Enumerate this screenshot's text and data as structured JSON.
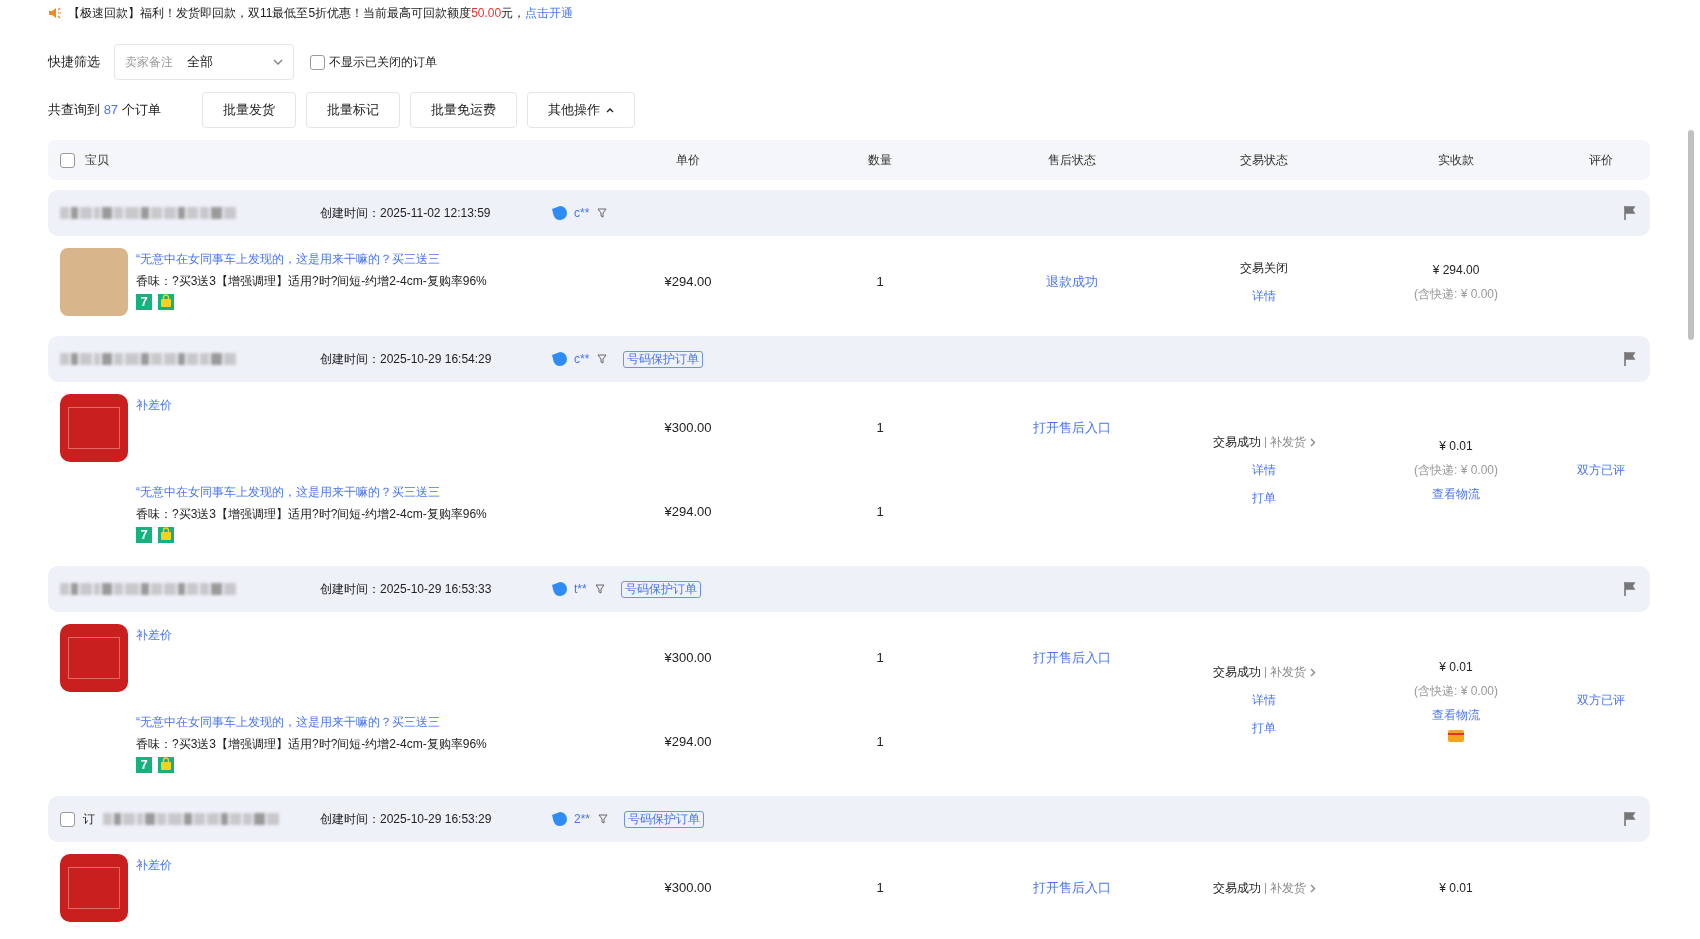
{
  "notice": {
    "text": "【极速回款】福利！发货即回款，双11最低至5折优惠！当前最高可回款额度",
    "amount": "50.00",
    "suffix": "元，",
    "link": "点击开通"
  },
  "filter": {
    "label": "快捷筛选",
    "select_label": "卖家备注",
    "select_value": "全部",
    "hide_closed": {
      "label": "不显示已关闭的订单",
      "checked": false
    }
  },
  "summary": {
    "prefix": "共查询到",
    "count": "87",
    "suffix": "个订单"
  },
  "actions": [
    {
      "label": "批量发货",
      "kind": "plain"
    },
    {
      "label": "批量标记",
      "kind": "plain"
    },
    {
      "label": "批量免运费",
      "kind": "plain"
    },
    {
      "label": "其他操作",
      "kind": "menu",
      "expanded": true
    }
  ],
  "table": {
    "select_all": {
      "checked": false
    },
    "columns": [
      "宝贝",
      "单价",
      "数量",
      "售后状态",
      "交易状态",
      "实收款",
      "评价"
    ]
  },
  "orders": [
    {
      "created": "创建时间：2025-11-02 12:13:59",
      "buyer": "c**",
      "items": [
        {
          "kind": "photo",
          "title": "“无意中在女同事车上发现的，这是用来干嘛的？买三送三",
          "spec": "香味：?买3送3【增强调理】适用?时?间短-约增2-4cm-复购率96%",
          "tags": [
            {
              "kind": "seven",
              "text": "7"
            },
            {
              "kind": "bag"
            }
          ],
          "price": "¥294.00",
          "qty": "1",
          "after_sale": "退款成功"
        }
      ],
      "trade": {
        "status": "交易关闭",
        "links": [
          "详情"
        ]
      },
      "received": {
        "amount": "¥ 294.00",
        "shipping": "(含快递: ¥ 0.00)"
      }
    },
    {
      "created": "创建时间：2025-10-29 16:54:29",
      "buyer": "c**",
      "tag": "号码保护订单",
      "items": [
        {
          "kind": "patch",
          "title": "补差价",
          "price": "¥300.00",
          "qty": "1",
          "after_sale": "打开售后入口"
        },
        {
          "kind": "plain",
          "title": "“无意中在女同事车上发现的，这是用来干嘛的？买三送三",
          "spec": "香味：?买3送3【增强调理】适用?时?间短-约增2-4cm-复购率96%",
          "tags": [
            {
              "kind": "seven",
              "text": "7"
            },
            {
              "kind": "bag"
            }
          ],
          "price": "¥294.00",
          "qty": "1"
        }
      ],
      "trade": {
        "status": "交易成功",
        "resend": "补发货",
        "links": [
          "详情",
          "打单"
        ]
      },
      "received": {
        "amount": "¥ 0.01",
        "shipping": "(含快递: ¥ 0.00)",
        "links": [
          "查看物流"
        ]
      },
      "review": "双方已评"
    },
    {
      "created": "创建时间：2025-10-29 16:53:33",
      "buyer": "t**",
      "tag": "号码保护订单",
      "items": [
        {
          "kind": "patch",
          "title": "补差价",
          "price": "¥300.00",
          "qty": "1",
          "after_sale": "打开售后入口"
        },
        {
          "kind": "plain",
          "title": "“无意中在女同事车上发现的，这是用来干嘛的？买三送三",
          "spec": "香味：?买3送3【增强调理】适用?时?间短-约增2-4cm-复购率96%",
          "tags": [
            {
              "kind": "seven",
              "text": "7"
            },
            {
              "kind": "bag"
            }
          ],
          "price": "¥294.00",
          "qty": "1"
        }
      ],
      "trade": {
        "status": "交易成功",
        "resend": "补发货",
        "links": [
          "详情",
          "打单"
        ]
      },
      "received": {
        "amount": "¥ 0.01",
        "shipping": "(含快递: ¥ 0.00)",
        "links": [
          "查看物流"
        ],
        "card": true
      },
      "review": "双方已评"
    },
    {
      "id_prefix": "订",
      "checked": false,
      "created": "创建时间：2025-10-29 16:53:29",
      "buyer": "2**",
      "tag": "号码保护订单",
      "items": [
        {
          "kind": "patch",
          "title": "补差价",
          "price": "¥300.00",
          "qty": "1",
          "after_sale": "打开售后入口"
        }
      ],
      "trade": {
        "status": "交易成功",
        "resend": "补发货"
      },
      "received": {
        "amount": "¥ 0.01"
      }
    }
  ]
}
